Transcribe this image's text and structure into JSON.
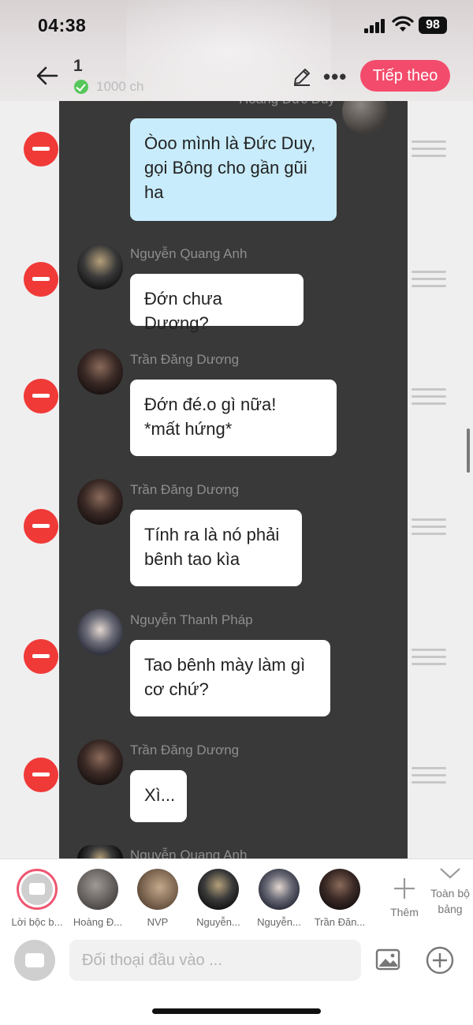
{
  "status_bar": {
    "time": "04:38",
    "battery": "98"
  },
  "header": {
    "draft_number": "1",
    "char_count": "1000 ch",
    "next_label": "Tiếp theo"
  },
  "messages": [
    {
      "sender": "Hoàng Đức Duy",
      "text_lines": [
        "Òoo mình là Đức Duy,",
        "gọi Bông cho gần gũi",
        "ha"
      ],
      "self": true
    },
    {
      "sender": "Nguyễn Quang Anh",
      "text_lines": [
        "Đớn chưa Dương?"
      ],
      "self": false
    },
    {
      "sender": "Trần Đăng Dương",
      "text_lines": [
        "Đớn đé.o gì nữa!",
        "*mất hứng*"
      ],
      "self": false
    },
    {
      "sender": "Trần Đăng Dương",
      "text_lines": [
        "Tính ra là nó phải",
        "bênh tao kìa"
      ],
      "self": false
    },
    {
      "sender": "Nguyễn Thanh Pháp",
      "text_lines": [
        "Tao bênh mày làm gì",
        "cơ chứ?"
      ],
      "self": false
    },
    {
      "sender": "Trần Đăng Dương",
      "text_lines": [
        "Xì..."
      ],
      "self": false
    },
    {
      "sender": "Nguyễn Quang Anh",
      "text_lines": [],
      "self": false
    }
  ],
  "cast": [
    {
      "name": "Lời bộc b..."
    },
    {
      "name": "Hoàng Đ..."
    },
    {
      "name": "NVP"
    },
    {
      "name": "Nguyễn..."
    },
    {
      "name": "Nguyễn..."
    },
    {
      "name": "Trần Đăn..."
    }
  ],
  "cast_actions": {
    "add_label": "Thêm",
    "all_label": "Toàn bộ bảng"
  },
  "composer": {
    "placeholder": "Đối thoại đầu vào ..."
  },
  "colors": {
    "accent": "#f34b6c",
    "remove": "#f03a38",
    "self_bubble": "#c8ecfb",
    "chat_bg": "#393939"
  }
}
